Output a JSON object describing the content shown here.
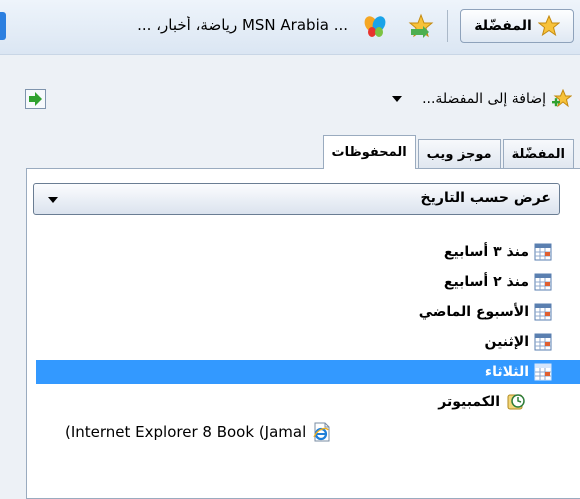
{
  "toolbar": {
    "favorites_button_label": "المفضّلة",
    "msn_link_text": "... MSN Arabia رياضة، أخبار، ..."
  },
  "panel": {
    "add_to_favorites_label": "إضافة إلى المفضلة...",
    "tabs": [
      {
        "label": "المفضّلة",
        "active": false
      },
      {
        "label": "موجز ويب",
        "active": false
      },
      {
        "label": "المحفوظات",
        "active": true
      }
    ],
    "view_by": "عرض حسب التاريخ",
    "history": [
      {
        "label": "منذ ٣ أسابيع",
        "selected": false
      },
      {
        "label": "منذ ٢ أسابيع",
        "selected": false
      },
      {
        "label": "الأسبوع الماضي",
        "selected": false
      },
      {
        "label": "الإثنين",
        "selected": false
      },
      {
        "label": "الثلاثاء",
        "selected": true
      }
    ],
    "computer_label": "الكمبيوتر",
    "ie_item_label": "(Internet Explorer 8 Book (Jamal"
  }
}
